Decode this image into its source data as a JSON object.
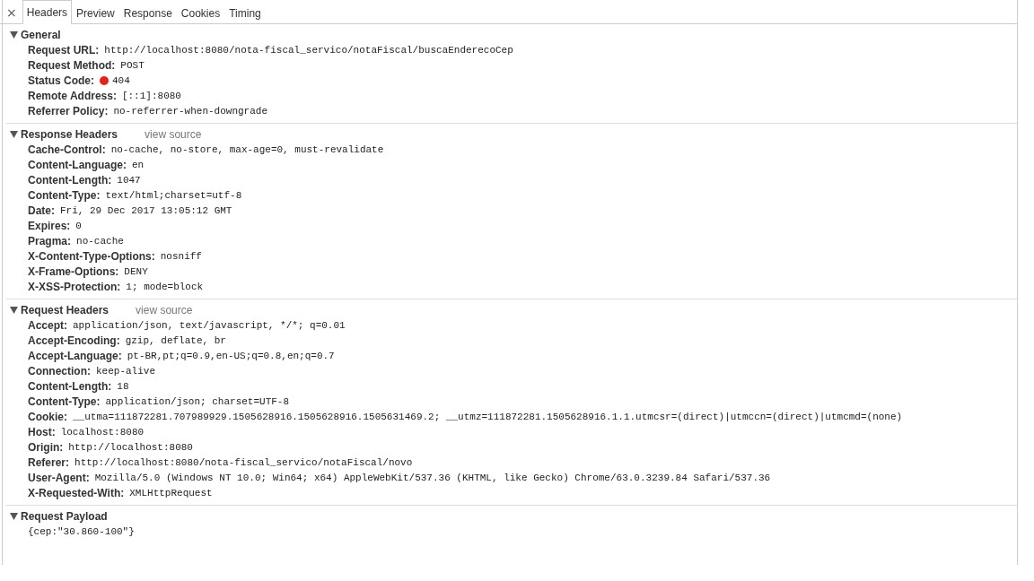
{
  "tabs": [
    {
      "label": "Headers",
      "selected": true
    },
    {
      "label": "Preview",
      "selected": false
    },
    {
      "label": "Response",
      "selected": false
    },
    {
      "label": "Cookies",
      "selected": false
    },
    {
      "label": "Timing",
      "selected": false
    }
  ],
  "close_button": "×",
  "sections": [
    {
      "title": "General",
      "expanded": true,
      "rows": [
        {
          "name": "Request URL:",
          "value": "http://localhost:8080/nota-fiscal_servico/notaFiscal/buscaEnderecoCep"
        },
        {
          "name": "Request Method:",
          "value": "POST"
        },
        {
          "name": "Status Code:",
          "value": "404",
          "color": "#e2231a"
        },
        {
          "name": "Remote Address:",
          "value": "[::1]:8080"
        },
        {
          "name": "Referrer Policy:",
          "value": "no-referrer-when-downgrade"
        }
      ]
    },
    {
      "title": "Response Headers",
      "view_source": "view source",
      "expanded": true,
      "rows": [
        {
          "name": "Cache-Control:",
          "value": "no-cache, no-store, max-age=0, must-revalidate"
        },
        {
          "name": "Content-Language:",
          "value": "en"
        },
        {
          "name": "Content-Length:",
          "value": "1047"
        },
        {
          "name": "Content-Type:",
          "value": "text/html;charset=utf-8"
        },
        {
          "name": "Date:",
          "value": "Fri, 29 Dec 2017 13:05:12 GMT"
        },
        {
          "name": "Expires:",
          "value": "0"
        },
        {
          "name": "Pragma:",
          "value": "no-cache"
        },
        {
          "name": "X-Content-Type-Options:",
          "value": "nosniff"
        },
        {
          "name": "X-Frame-Options:",
          "value": "DENY"
        },
        {
          "name": "X-XSS-Protection:",
          "value": "1; mode=block"
        }
      ]
    },
    {
      "title": "Request Headers",
      "view_source": "view source",
      "expanded": true,
      "rows": [
        {
          "name": "Accept:",
          "value": "application/json, text/javascript, */*; q=0.01"
        },
        {
          "name": "Accept-Encoding:",
          "value": "gzip, deflate, br"
        },
        {
          "name": "Accept-Language:",
          "value": "pt-BR,pt;q=0.9,en-US;q=0.8,en;q=0.7"
        },
        {
          "name": "Connection:",
          "value": "keep-alive"
        },
        {
          "name": "Content-Length:",
          "value": "18"
        },
        {
          "name": "Content-Type:",
          "value": "application/json; charset=UTF-8"
        },
        {
          "name": "Cookie:",
          "value": "__utma=111872281.707989929.1505628916.1505628916.1505631469.2; __utmz=111872281.1505628916.1.1.utmcsr=(direct)|utmccn=(direct)|utmcmd=(none)"
        },
        {
          "name": "Host:",
          "value": "localhost:8080"
        },
        {
          "name": "Origin:",
          "value": "http://localhost:8080"
        },
        {
          "name": "Referer:",
          "value": "http://localhost:8080/nota-fiscal_servico/notaFiscal/novo"
        },
        {
          "name": "User-Agent:",
          "value": "Mozilla/5.0 (Windows NT 10.0; Win64; x64) AppleWebKit/537.36 (KHTML, like Gecko) Chrome/63.0.3239.84 Safari/537.36"
        },
        {
          "name": "X-Requested-With:",
          "value": "XMLHttpRequest"
        }
      ]
    },
    {
      "title": "Request Payload",
      "expanded": true,
      "payload": "{cep:\"30.860-100\"}"
    }
  ]
}
